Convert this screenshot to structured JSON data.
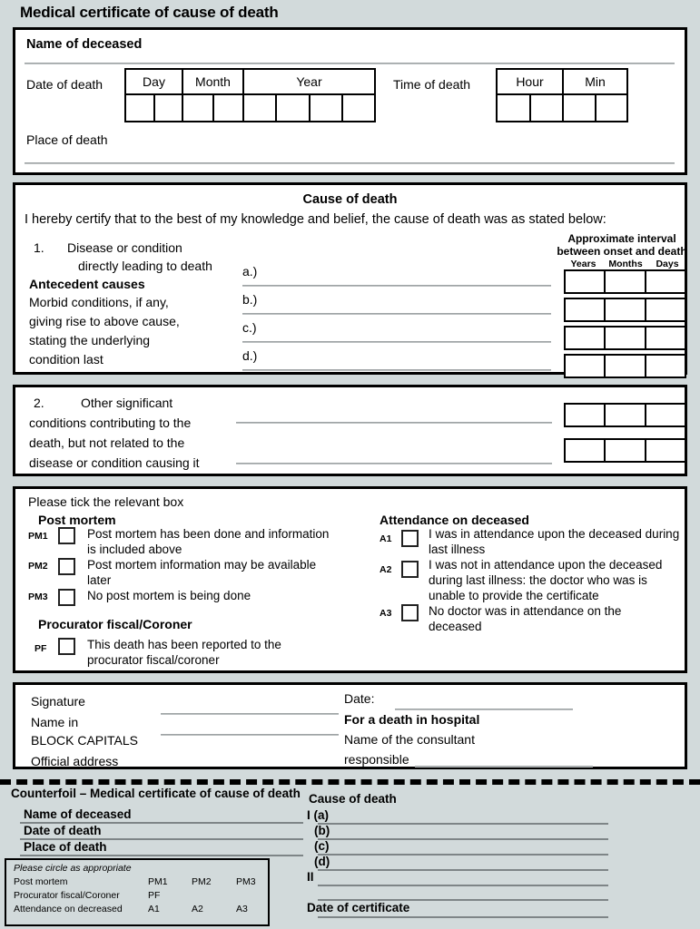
{
  "document": {
    "title": "Medical certificate of cause of death",
    "background_color": "#d2dadb"
  },
  "deceased_section": {
    "name_label": "Name of deceased",
    "date_of_death_label": "Date of death",
    "date_headers": [
      "Day",
      "Month",
      "Year"
    ],
    "date_cell_counts": [
      2,
      2,
      4
    ],
    "time_of_death_label": "Time of death",
    "time_headers": [
      "Hour",
      "Min"
    ],
    "time_cell_counts": [
      2,
      2
    ],
    "place_label": "Place of death"
  },
  "cause_section": {
    "heading": "Cause of death",
    "certify_text": "I hereby certify that to the best of my knowledge and belief, the cause of death was as stated below:",
    "item_number": "1.",
    "item_line1": "Disease or condition",
    "item_line2": "directly leading to death",
    "antecedent_heading": "Antecedent causes",
    "antecedent_lines": [
      "Morbid conditions, if any,",
      "giving rise to above cause,",
      "stating the underlying",
      "condition last"
    ],
    "entry_labels": [
      "a.)",
      "b.)",
      "c.)",
      "d.)"
    ],
    "interval_heading_line1": "Approximate interval",
    "interval_heading_line2": "between onset and death",
    "interval_columns": [
      "Years",
      "Months",
      "Days"
    ]
  },
  "other_conditions_section": {
    "item_number": "2.",
    "lines": [
      "Other significant",
      "conditions contributing to the",
      "death, but not related to the",
      "disease or condition causing it"
    ]
  },
  "tickbox_section": {
    "instruction": "Please tick the relevant box",
    "post_mortem_heading": "Post mortem",
    "post_mortem_options": [
      {
        "code": "PM1",
        "lines": [
          "Post mortem has been done and information",
          "is included above"
        ]
      },
      {
        "code": "PM2",
        "lines": [
          "Post mortem information may be available",
          "later"
        ]
      },
      {
        "code": "PM3",
        "lines": [
          "No post mortem is being done"
        ]
      }
    ],
    "procurator_heading": "Procurator fiscal/Coroner",
    "procurator_option": {
      "code": "PF",
      "lines": [
        "This death has been reported to the",
        "procurator fiscal/coroner"
      ]
    },
    "attendance_heading": "Attendance on deceased",
    "attendance_options": [
      {
        "code": "A1",
        "lines": [
          "I was in attendance upon the deceased during",
          "last illness"
        ]
      },
      {
        "code": "A2",
        "lines": [
          "I was not in attendance upon the deceased",
          "during last illness: the doctor who was is",
          "unable to provide the certificate"
        ]
      },
      {
        "code": "A3",
        "lines": [
          "No doctor was in attendance on the",
          "deceased"
        ]
      }
    ]
  },
  "signature_section": {
    "signature_label": "Signature",
    "name_label_line1": "Name in",
    "name_label_line2": "BLOCK CAPITALS",
    "address_label": "Official address",
    "date_label": "Date:",
    "hospital_heading": "For a death in hospital",
    "consultant_line1": "Name of the consultant",
    "consultant_line2": "responsible"
  },
  "counterfoil": {
    "title": "Counterfoil – Medical certificate of cause of death",
    "fields": [
      "Name of deceased",
      "Date of death",
      "Place of death"
    ],
    "circle_box": {
      "instruction": "Please circle as appropriate",
      "rows": [
        {
          "label": "Post mortem",
          "codes": [
            "PM1",
            "PM2",
            "PM3"
          ]
        },
        {
          "label": "Procurator fiscal/Coroner",
          "codes": [
            "PF",
            "",
            ""
          ]
        },
        {
          "label": "Attendance on decreased",
          "codes": [
            "A1",
            "A2",
            "A3"
          ]
        }
      ]
    },
    "cause_heading": "Cause of death",
    "cause_entries": [
      "I (a)",
      "(b)",
      "(c)",
      "(d)",
      "II"
    ],
    "date_of_certificate_label": "Date of certificate"
  }
}
